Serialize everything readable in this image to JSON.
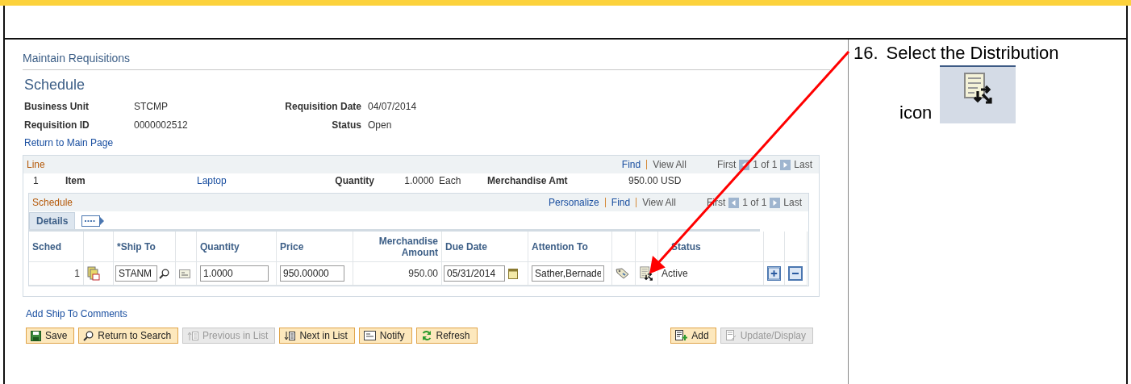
{
  "page": {
    "breadcrumb": "Maintain Requisitions",
    "title": "Schedule"
  },
  "fields": [
    {
      "label": "Business Unit",
      "value": "STCMP"
    },
    {
      "label": "Requisition Date",
      "value": "04/07/2014"
    },
    {
      "label": "Requisition ID",
      "value": "0000002512"
    },
    {
      "label": "Status",
      "value": "Open"
    }
  ],
  "return_link": "Return to Main Page",
  "line": {
    "title": "Line",
    "find": "Find",
    "view_all": "View All",
    "first": "First",
    "count": "1 of 1",
    "last": "Last",
    "number": "1",
    "item_label": "Item",
    "item": "Laptop",
    "quantity_label": "Quantity",
    "quantity": "1.0000",
    "uom": "Each",
    "amount_label": "Merchandise Amt",
    "amount": "950.00 USD"
  },
  "schedule": {
    "title": "Schedule",
    "personalize": "Personalize",
    "find": "Find",
    "view_all": "View All",
    "first": "First",
    "count": "1 of 1",
    "last": "Last",
    "tabs": [
      {
        "label": "Details",
        "selected": true
      }
    ],
    "columns": {
      "sched": "Sched",
      "ship_to": "*Ship To",
      "quantity": "Quantity",
      "price": "Price",
      "amount": "Merchandise Amount",
      "due_date": "Due Date",
      "attention_to": "Attention To",
      "status": "Status"
    },
    "rows": [
      {
        "sched": "1",
        "ship_to": "STANM",
        "quantity": "1.0000",
        "price": "950.00000",
        "amount": "950.00",
        "due_date": "05/31/2014",
        "attention_to": "Sather,Bernade",
        "status": "Active"
      }
    ]
  },
  "comments_link": "Add Ship To Comments",
  "toolbar_left": [
    {
      "kind": "save",
      "label": "Save",
      "disabled": false
    },
    {
      "kind": "search",
      "label": "Return to Search",
      "disabled": false
    },
    {
      "kind": "previous",
      "label": "Previous in List",
      "disabled": true
    },
    {
      "kind": "next",
      "label": "Next in List",
      "disabled": false
    },
    {
      "kind": "notify",
      "label": "Notify",
      "disabled": false
    },
    {
      "kind": "refresh",
      "label": "Refresh",
      "disabled": false
    }
  ],
  "toolbar_right": [
    {
      "kind": "add",
      "label": "Add",
      "disabled": false
    },
    {
      "kind": "update",
      "label": "Update/Display",
      "disabled": true
    }
  ],
  "instruction": {
    "number": "16.",
    "text": "Select the Distribution",
    "icon_label": "icon"
  }
}
